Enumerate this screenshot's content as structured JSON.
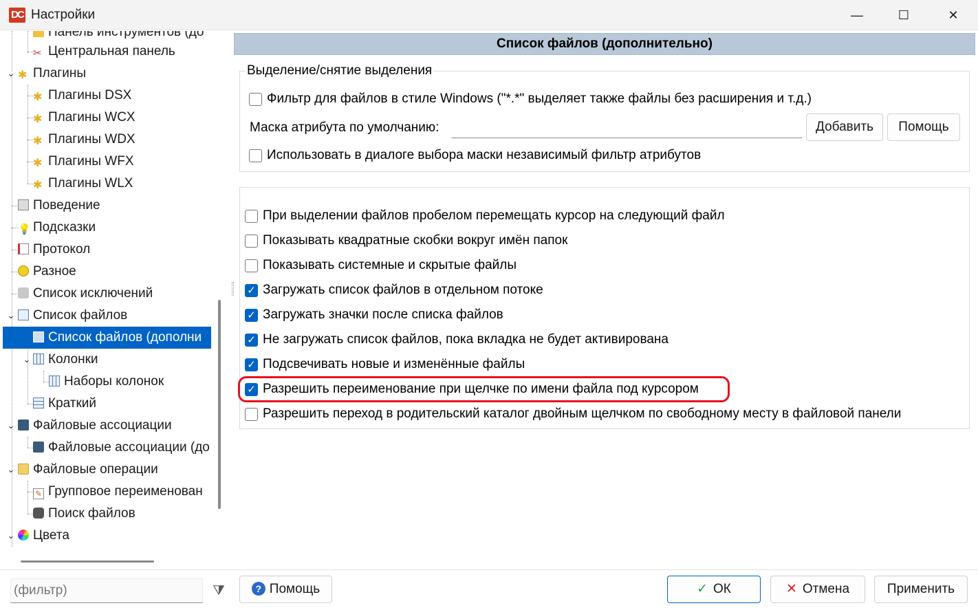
{
  "window": {
    "title": "Настройки",
    "app_icon": "dc-app-icon",
    "minimize_glyph": "—",
    "maximize_glyph": "☐",
    "close_glyph": "✕"
  },
  "tree": {
    "items": [
      {
        "label": "Панель инструментов (до",
        "icon": "toolbar-icon"
      },
      {
        "label": "Центральная панель",
        "icon": "scissors-icon"
      },
      {
        "label": "Плагины",
        "icon": "puzzle-icon"
      },
      {
        "label": "Плагины DSX",
        "icon": "puzzle-icon"
      },
      {
        "label": "Плагины WCX",
        "icon": "puzzle-icon"
      },
      {
        "label": "Плагины WDX",
        "icon": "puzzle-icon"
      },
      {
        "label": "Плагины WFX",
        "icon": "puzzle-icon"
      },
      {
        "label": "Плагины WLX",
        "icon": "puzzle-icon"
      },
      {
        "label": "Поведение",
        "icon": "behavior-icon"
      },
      {
        "label": "Подсказки",
        "icon": "lightbulb-icon"
      },
      {
        "label": "Протокол",
        "icon": "log-icon"
      },
      {
        "label": "Разное",
        "icon": "misc-icon"
      },
      {
        "label": "Список исключений",
        "icon": "exclusions-icon"
      },
      {
        "label": "Список файлов",
        "icon": "file-list-icon"
      },
      {
        "label": "Список файлов (дополни",
        "icon": "file-list-icon"
      },
      {
        "label": "Колонки",
        "icon": "columns-icon"
      },
      {
        "label": "Наборы колонок",
        "icon": "column-sets-icon"
      },
      {
        "label": "Краткий",
        "icon": "brief-icon"
      },
      {
        "label": "Файловые ассоциации",
        "icon": "file-assoc-icon"
      },
      {
        "label": "Файловые ассоциации (до",
        "icon": "file-assoc-icon"
      },
      {
        "label": "Файловые операции",
        "icon": "folder-icon"
      },
      {
        "label": "Групповое переименован",
        "icon": "rename-icon"
      },
      {
        "label": "Поиск файлов",
        "icon": "binoculars-icon"
      },
      {
        "label": "Цвета",
        "icon": "color-wheel-icon"
      }
    ]
  },
  "main": {
    "header": "Список файлов (дополнительно)",
    "selection_group": {
      "title": "Выделение/снятие выделения",
      "windows_filter": {
        "label": "Фильтр для файлов в стиле Windows (\"*.*\" выделяет также файлы без расширения и т.д.)",
        "checked": false
      },
      "attr_mask_label": "Маска атрибута по умолчанию:",
      "attr_mask_value": "",
      "add_button": "Добавить",
      "help_button": "Помощь",
      "independent_filter": {
        "label": "Использовать в диалоге выбора маски независимый фильтр атрибутов",
        "checked": false
      }
    },
    "options": [
      {
        "label": "При выделении файлов пробелом перемещать курсор на следующий файл",
        "checked": false
      },
      {
        "label": "Показывать квадратные скобки вокруг имён папок",
        "checked": false
      },
      {
        "label": "Показывать системные и скрытые файлы",
        "checked": false
      },
      {
        "label": "Загружать список файлов в отдельном потоке",
        "checked": true
      },
      {
        "label": "Загружать значки после списка файлов",
        "checked": true
      },
      {
        "label": "Не загружать список файлов, пока вкладка не будет активирована",
        "checked": true
      },
      {
        "label": "Подсвечивать новые и изменённые файлы",
        "checked": true
      },
      {
        "label": "Разрешить переименование при щелчке по имени файла под курсором",
        "checked": true
      },
      {
        "label": "Разрешить переход в родительский каталог двойным щелчком по свободному месту в файловой панели",
        "checked": false
      }
    ],
    "highlight_color": "#e8101c"
  },
  "footer": {
    "filter_placeholder": "(фильтр)",
    "help_button": "Помощь",
    "ok_button": "ОК",
    "cancel_button": "Отмена",
    "apply_button": "Применить"
  },
  "colors": {
    "accent": "#0063c6",
    "header_bg": "#b8c8d8",
    "ok_check": "#21a33a",
    "cancel_x": "#e02020"
  }
}
